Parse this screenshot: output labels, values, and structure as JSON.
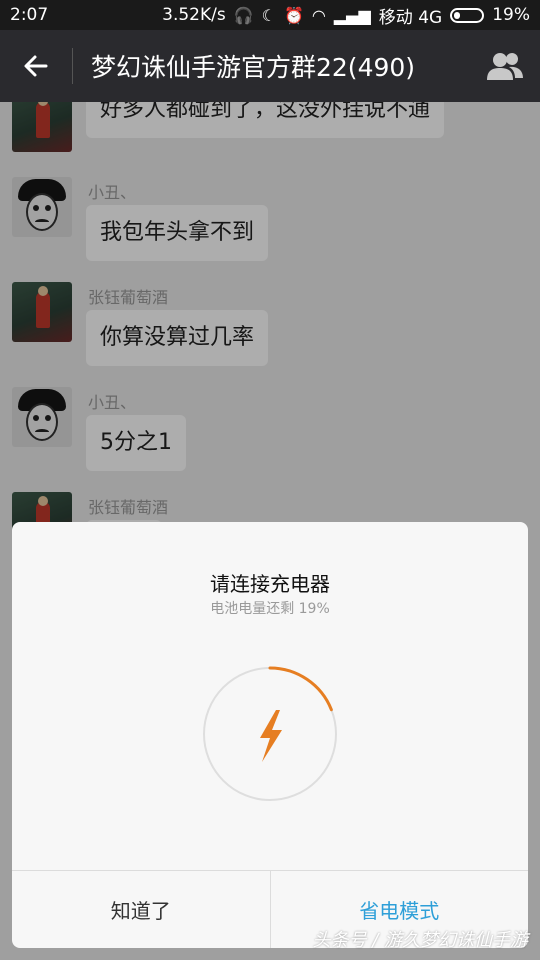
{
  "status_bar": {
    "time": "2:07",
    "speed": "3.52K/s",
    "carrier": "移动 4G",
    "battery": "19%"
  },
  "nav": {
    "title": "梦幻诛仙手游官方群22(490)"
  },
  "messages": [
    {
      "sender": "",
      "text": "好多人都碰到了，这没外挂说不通",
      "avatar": "girl-avatar"
    },
    {
      "sender": "小丑、",
      "text": "我包年头拿不到",
      "avatar": "clown-avatar"
    },
    {
      "sender": "张钰葡萄酒",
      "text": "你算没算过几率",
      "avatar": "girl-avatar"
    },
    {
      "sender": "小丑、",
      "text": "5分之1",
      "avatar": "clown-avatar"
    },
    {
      "sender": "张钰葡萄酒",
      "text": "",
      "avatar": "girl-avatar"
    }
  ],
  "dialog": {
    "title": "请连接充电器",
    "subtitle": "电池电量还剩 19%",
    "battery_level": 0.19,
    "accent_color": "#e67e22",
    "left_button": "知道了",
    "right_button": "省电模式"
  },
  "watermark": "头条号 / 游久梦幻诛仙手游"
}
